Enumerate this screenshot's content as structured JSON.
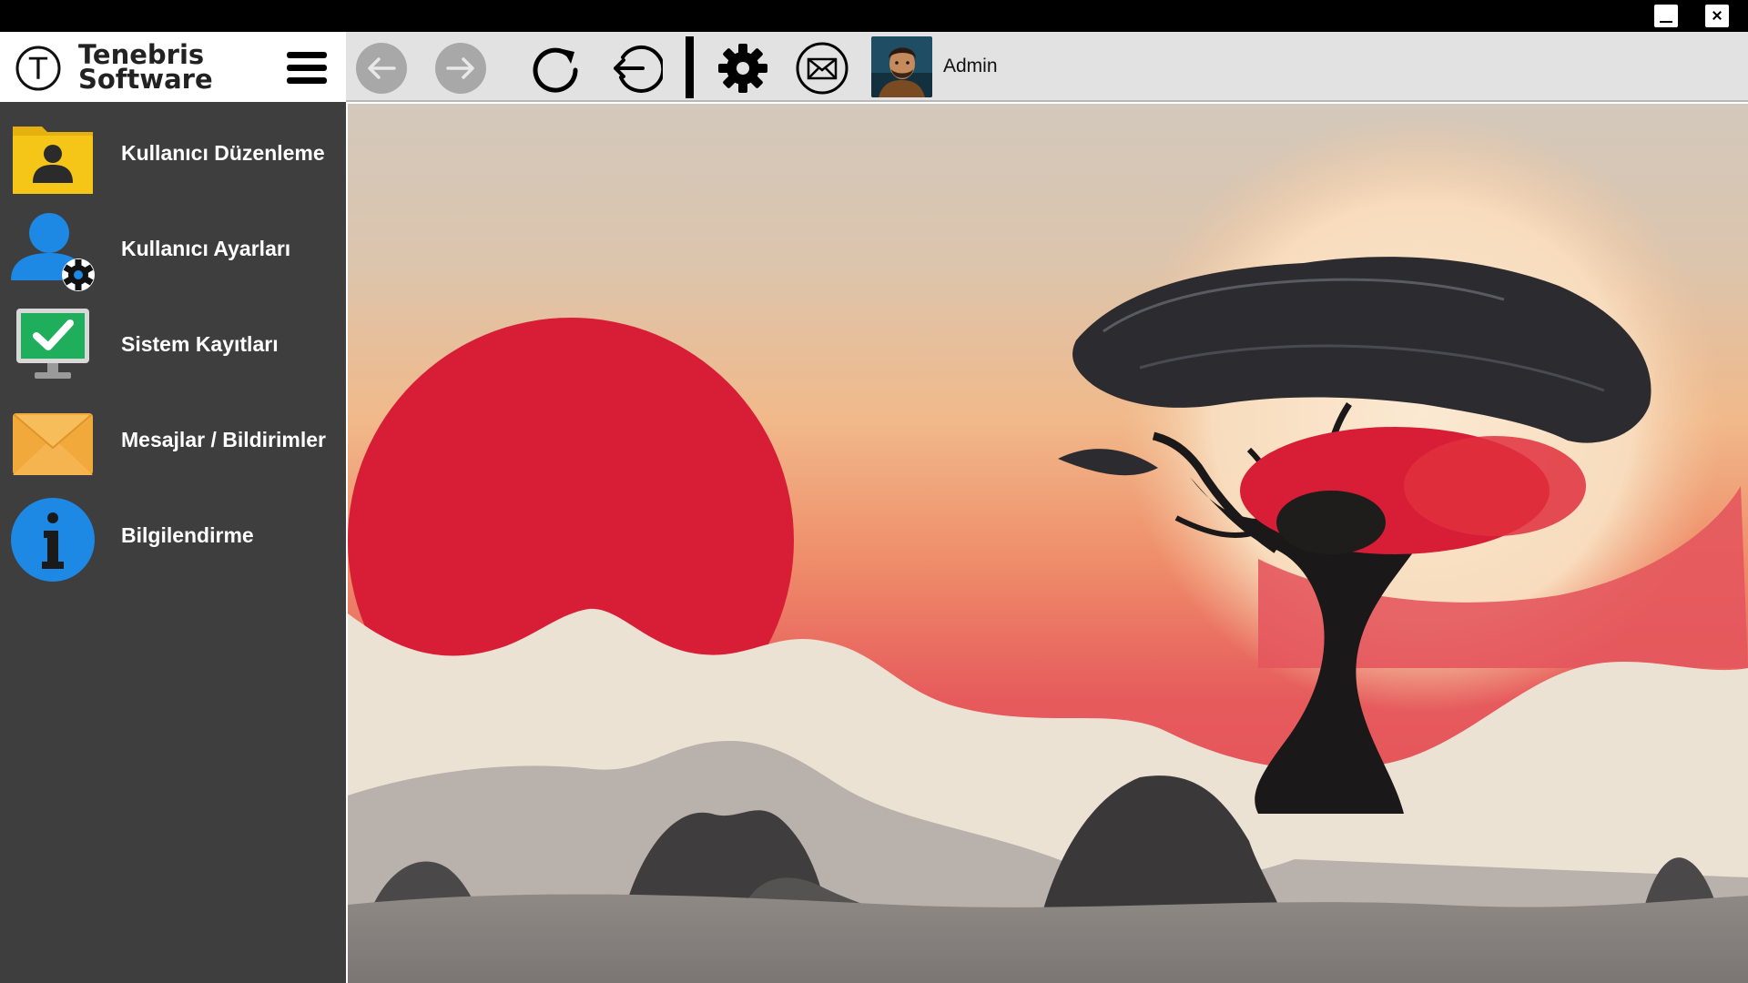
{
  "app": {
    "brand_line1": "Tenebris",
    "brand_line2": "Software",
    "brand_logo_letter": "T"
  },
  "window": {
    "minimize_icon": "minimize-icon",
    "close_icon": "close-icon"
  },
  "toolbar": {
    "icons": [
      "menu-icon",
      "back-arrow-icon",
      "forward-arrow-icon",
      "refresh-icon",
      "logout-icon",
      "gear-icon",
      "mail-icon"
    ],
    "nav_disabled": true,
    "user_name": "Admin"
  },
  "sidebar": {
    "items": [
      {
        "label": "Kullanıcı Düzenleme",
        "icon": "user-folder-icon"
      },
      {
        "label": "Kullanıcı Ayarları",
        "icon": "user-settings-icon"
      },
      {
        "label": "Sistem Kayıtları",
        "icon": "monitor-check-icon"
      },
      {
        "label": "Mesajlar / Bildirimler",
        "icon": "envelope-icon"
      },
      {
        "label": "Bilgilendirme",
        "icon": "info-icon"
      }
    ]
  },
  "colors": {
    "titlebar": "#000000",
    "toolbar": "#e2e2e2",
    "sidebar": "#3e3e3e",
    "sidebar_text": "#ffffff",
    "sun_red": "#d81e36",
    "folder_yellow": "#f5c518",
    "info_blue": "#1e88e5",
    "mail_orange": "#f2a93b",
    "check_green": "#1fae5b"
  }
}
